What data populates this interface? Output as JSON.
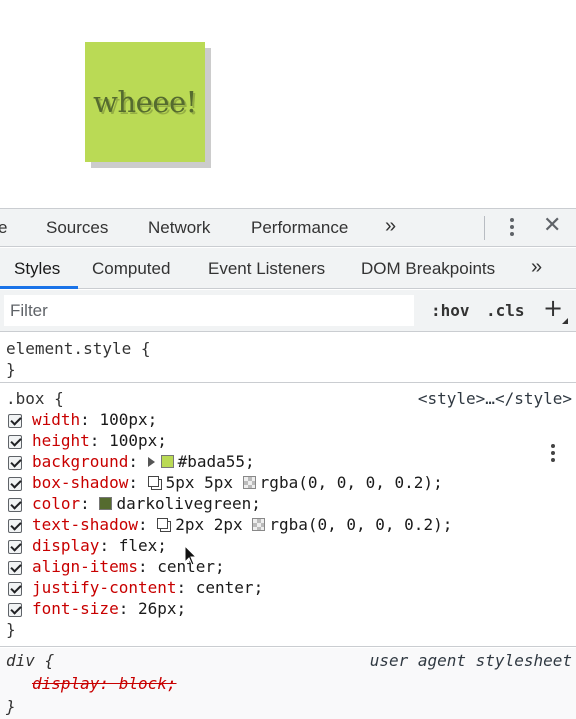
{
  "preview": {
    "box_text": "wheee!"
  },
  "main_tabs": [
    "e",
    "Sources",
    "Network",
    "Performance",
    "»"
  ],
  "sub_tabs": [
    "Styles",
    "Computed",
    "Event Listeners",
    "DOM Breakpoints",
    "»"
  ],
  "filter": {
    "placeholder": "Filter",
    "hov": ":hov",
    "cls": ".cls",
    "add": "+"
  },
  "element_style": {
    "selector": "element.style {",
    "close": "}"
  },
  "box_rule": {
    "selector": ".box {",
    "source": "<style>…</style>",
    "close": "}",
    "declarations": [
      {
        "prop": "width",
        "value": "100px;"
      },
      {
        "prop": "height",
        "value": "100px;"
      },
      {
        "prop": "background",
        "value": "#bada55;",
        "color": "#bada55"
      },
      {
        "prop": "box-shadow",
        "value_a": "5px 5px",
        "value_b": "rgba(0, 0, 0, 0.2);"
      },
      {
        "prop": "color",
        "value": "darkolivegreen;",
        "color": "#556b2f"
      },
      {
        "prop": "text-shadow",
        "value_a": "2px 2px",
        "value_b": "rgba(0, 0, 0, 0.2);"
      },
      {
        "prop": "display",
        "value": "flex;"
      },
      {
        "prop": "align-items",
        "value": "center;"
      },
      {
        "prop": "justify-content",
        "value": "center;"
      },
      {
        "prop": "font-size",
        "value": "26px;"
      }
    ]
  },
  "div_rule": {
    "selector": "div {",
    "source": "user agent stylesheet",
    "declaration": "display: block;",
    "close": "}"
  }
}
